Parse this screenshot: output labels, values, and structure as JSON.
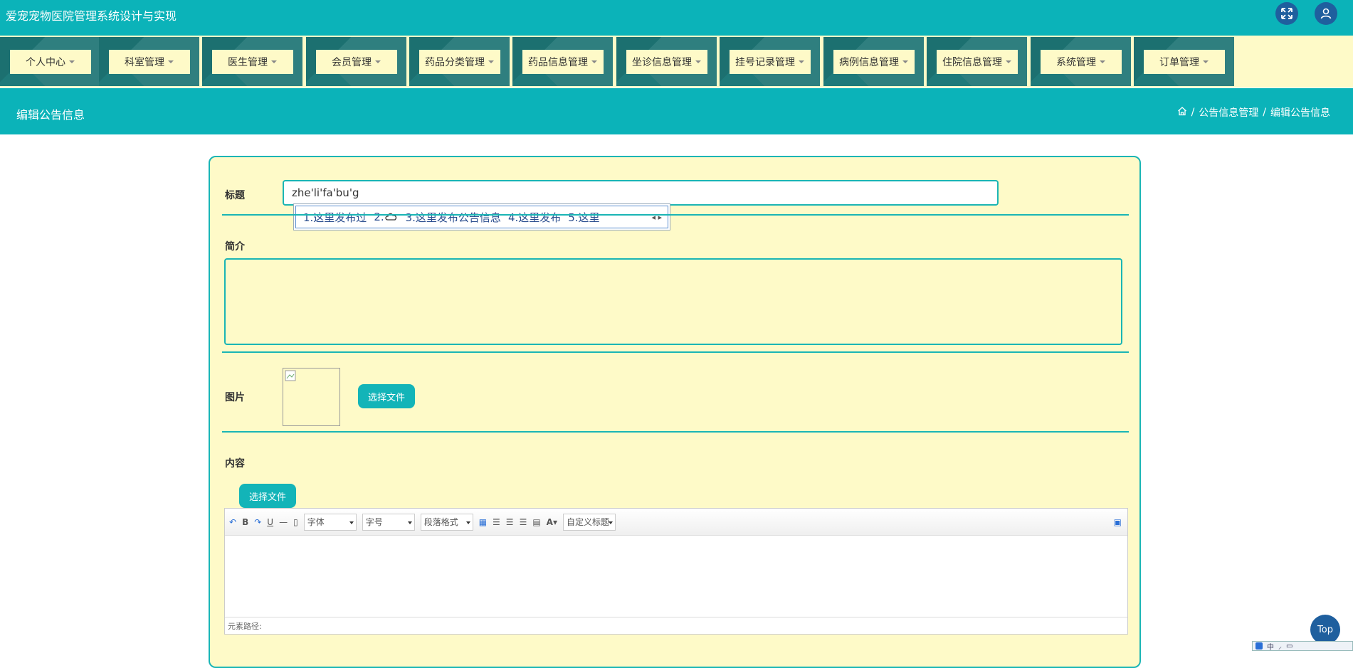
{
  "app": {
    "title": "爱宠宠物医院管理系统设计与实现"
  },
  "header_icons": {
    "fullscreen": "fullscreen-icon",
    "user": "user-icon"
  },
  "menu": [
    {
      "label": "个人中心"
    },
    {
      "label": "科室管理"
    },
    {
      "label": "医生管理"
    },
    {
      "label": "会员管理"
    },
    {
      "label": "药品分类管理"
    },
    {
      "label": "药品信息管理"
    },
    {
      "label": "坐诊信息管理"
    },
    {
      "label": "挂号记录管理"
    },
    {
      "label": "病例信息管理"
    },
    {
      "label": "住院信息管理"
    },
    {
      "label": "系统管理"
    },
    {
      "label": "订单管理"
    }
  ],
  "page": {
    "title": "编辑公告信息",
    "breadcrumb": [
      "公告信息管理",
      "编辑公告信息"
    ],
    "breadcrumb_sep": "/"
  },
  "form": {
    "title_label": "标题",
    "title_value": "zhe'li'fa'bu'g",
    "intro_label": "简介",
    "intro_value": "",
    "image_label": "图片",
    "choose_file": "选择文件",
    "content_label": "内容",
    "content_choose_file": "选择文件"
  },
  "ime": {
    "candidates": [
      "1.这里发布过",
      "2.",
      "3.这里发布公告信息",
      "4.这里发布",
      "5.这里"
    ]
  },
  "editor": {
    "font_select": "字体",
    "size_select": "字号",
    "paragraph_select": "段落格式",
    "custom_title_select": "自定义标题",
    "path_label": "元素路径:"
  },
  "top_button": "Top",
  "ime_tray": {
    "label": "中"
  },
  "colors": {
    "teal": "#0bb3b9",
    "cream": "#fefac8",
    "navy": "#1f5f9e"
  }
}
